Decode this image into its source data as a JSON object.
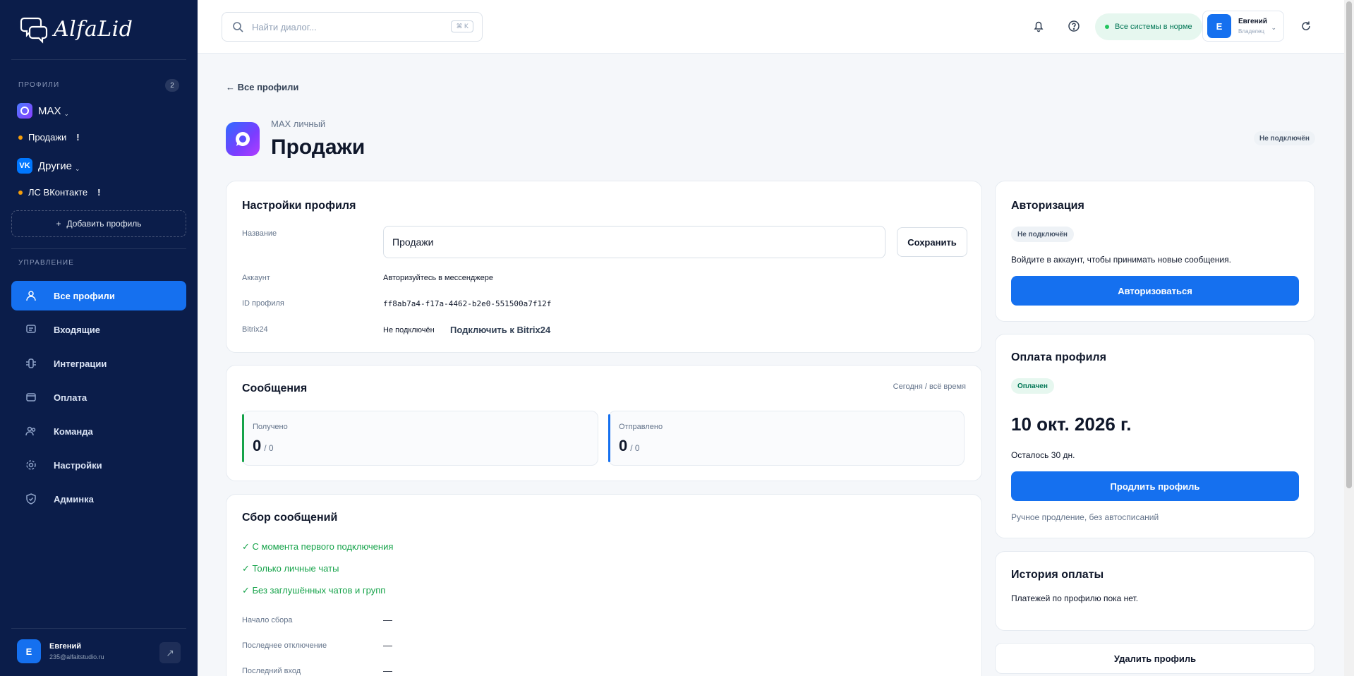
{
  "app": {
    "brand": "AlfaLid"
  },
  "sidebar": {
    "profiles_section": "ПРОФИЛИ",
    "profiles_count": "2",
    "groups": [
      {
        "name": "MAX",
        "items": [
          {
            "label": "Продажи",
            "flag": "!"
          }
        ]
      },
      {
        "name": "Другие",
        "items": [
          {
            "label": "ЛС ВКонтакте",
            "flag": "!"
          }
        ]
      }
    ],
    "add_profile": "Добавить профиль",
    "manage_section": "УПРАВЛЕНИЕ",
    "nav": [
      {
        "label": "Все профили",
        "icon": "user-icon",
        "active": true
      },
      {
        "label": "Входящие",
        "icon": "inbox-icon"
      },
      {
        "label": "Интеграции",
        "icon": "integrations-icon"
      },
      {
        "label": "Оплата",
        "icon": "wallet-icon"
      },
      {
        "label": "Команда",
        "icon": "team-icon"
      },
      {
        "label": "Настройки",
        "icon": "gear-icon"
      },
      {
        "label": "Админка",
        "icon": "shield-icon"
      }
    ],
    "user": {
      "initial": "E",
      "name": "Евгений",
      "email": "235@alfaitstudio.ru"
    }
  },
  "topbar": {
    "search_placeholder": "Найти диалог...",
    "search_shortcut": "⌘ K",
    "status": "Все системы в норме",
    "user": {
      "initial": "E",
      "name": "Евгений",
      "role": "Владелец"
    }
  },
  "page": {
    "back": "← Все профили",
    "subtitle": "MAX личный",
    "title": "Продажи",
    "badge": "Не подключён"
  },
  "settings": {
    "title": "Настройки профиля",
    "name_label": "Название",
    "name_value": "Продажи",
    "save": "Сохранить",
    "account_label": "Аккаунт",
    "account_value": "Авторизуйтесь в мессенджере",
    "id_label": "ID профиля",
    "id_value": "ff8ab7a4-f17a-4462-b2e0-551500a7f12f",
    "bitrix_label": "Bitrix24",
    "bitrix_value": "Не подключён",
    "bitrix_link": "Подключить к Bitrix24"
  },
  "messages": {
    "title": "Сообщения",
    "period": "Сегодня / всё время",
    "received_label": "Получено",
    "received_today": "0",
    "received_total": "/ 0",
    "sent_label": "Отправлено",
    "sent_today": "0",
    "sent_total": "/ 0"
  },
  "collection": {
    "title": "Сбор сообщений",
    "checks": [
      "✓ С момента первого подключения",
      "✓ Только личные чаты",
      "✓ Без заглушённых чатов и групп"
    ],
    "rows": [
      {
        "label": "Начало сбора",
        "value": "—"
      },
      {
        "label": "Последнее отключение",
        "value": "—"
      },
      {
        "label": "Последний вход",
        "value": "—"
      }
    ]
  },
  "auth": {
    "title": "Авторизация",
    "status": "Не подключён",
    "text": "Войдите в аккаунт, чтобы принимать новые сообщения.",
    "button": "Авторизоваться"
  },
  "payment": {
    "title": "Оплата профиля",
    "status": "Оплачен",
    "date": "10 окт. 2026 г.",
    "remaining": "Осталось 30 дн.",
    "button": "Продлить профиль",
    "note": "Ручное продление, без автосписаний"
  },
  "history": {
    "title": "История оплаты",
    "text": "Платежей по профилю пока нет."
  },
  "delete": "Удалить профиль",
  "colors": {
    "sidebar": "#0b1d4a",
    "accent": "#1570ef",
    "success": "#16a34a",
    "warning": "#f59e0b"
  }
}
